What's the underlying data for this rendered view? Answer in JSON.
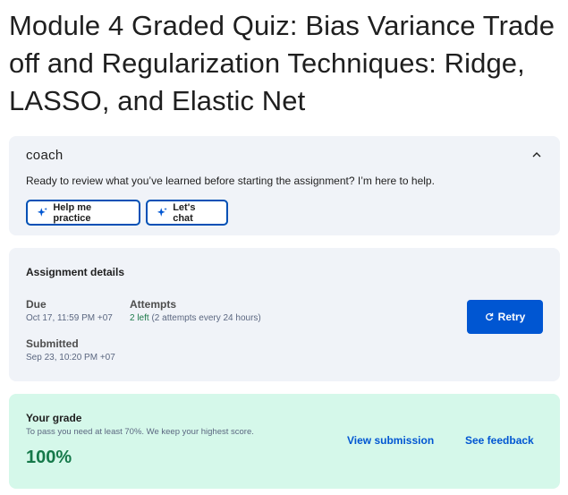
{
  "page_title": "Module 4 Graded Quiz: Bias Variance Trade off and Regularization Techniques: Ridge, LASSO, and Elastic Net",
  "coach": {
    "logo_text": "coach",
    "message": "Ready to review what you’ve learned before starting the assignment? I’m here to help.",
    "practice_label": "Help me practice",
    "chat_label": "Let's chat",
    "collapse_icon": "chevron-up-icon",
    "button_icon": "sparkle-icon"
  },
  "assignment": {
    "title": "Assignment details",
    "due_label": "Due",
    "due_value": "Oct 17, 11:59 PM +07",
    "attempts_label": "Attempts",
    "attempts_left": "2 left",
    "attempts_detail": " (2 attempts every 24 hours)",
    "submitted_label": "Submitted",
    "submitted_value": "Sep 23, 10:20 PM +07",
    "retry_label": "Retry",
    "retry_icon": "refresh-icon"
  },
  "grade": {
    "title": "Your grade",
    "subtitle": "To pass you need at least 70%. We keep your highest score.",
    "score": "100%",
    "view_link": "View submission",
    "feedback_link": "See feedback"
  },
  "colors": {
    "primary": "#0056d2",
    "success": "#15794a",
    "card_bg": "#f0f3f8",
    "grade_bg": "#d5f8ea"
  }
}
